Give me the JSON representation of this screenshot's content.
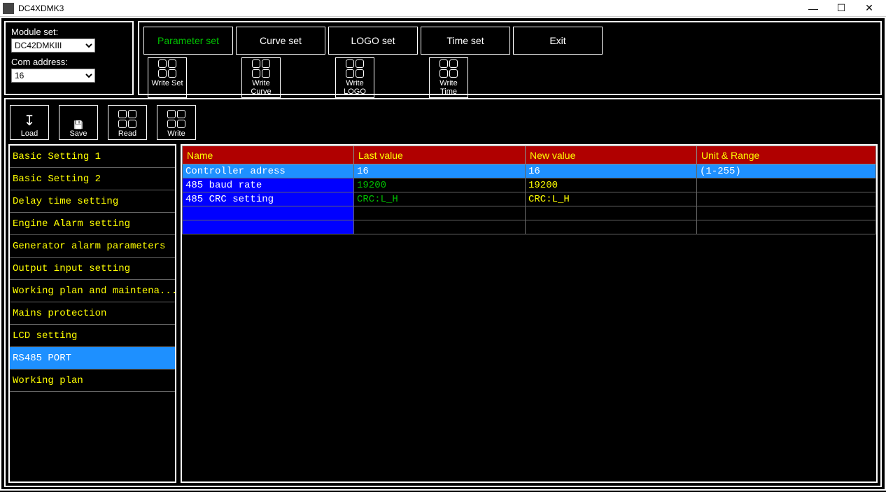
{
  "window": {
    "title": "DC4XDMK3"
  },
  "module_panel": {
    "module_label": "Module set:",
    "module_value": "DC42DMKIII",
    "com_label": "Com address:",
    "com_value": "16"
  },
  "tabs": {
    "param": "Parameter set",
    "curve": "Curve set",
    "logo": "LOGO set",
    "time": "Time set",
    "exit": "Exit"
  },
  "write_buttons": {
    "set": "Write Set",
    "curve": "Write Curve",
    "logo": "Write LOGO",
    "time": "Write Time"
  },
  "actions": {
    "load": "Load",
    "save": "Save",
    "read": "Read",
    "write": "Write"
  },
  "sidebar": [
    "Basic Setting 1",
    "Basic Setting 2",
    "Delay time setting",
    "Engine Alarm setting",
    "Generator alarm parameters",
    "Output input setting",
    "Working plan and maintena...",
    "Mains protection",
    "LCD setting",
    "RS485 PORT",
    "Working plan"
  ],
  "sidebar_selected": 9,
  "table": {
    "headers": {
      "name": "Name",
      "last": "Last value",
      "new": "New value",
      "unit": "Unit & Range"
    },
    "rows": [
      {
        "name": "Controller adress",
        "last": "16",
        "new": "16",
        "unit": "(1-255)",
        "sel": true
      },
      {
        "name": "485 baud rate",
        "last": "19200",
        "new": "19200",
        "unit": "",
        "sel": false
      },
      {
        "name": "485 CRC setting",
        "last": "CRC:L_H",
        "new": "CRC:L_H",
        "unit": "",
        "sel": false
      },
      {
        "name": "",
        "last": "",
        "new": "",
        "unit": "",
        "empty": true
      },
      {
        "name": "",
        "last": "",
        "new": "",
        "unit": "",
        "empty": true
      }
    ]
  }
}
